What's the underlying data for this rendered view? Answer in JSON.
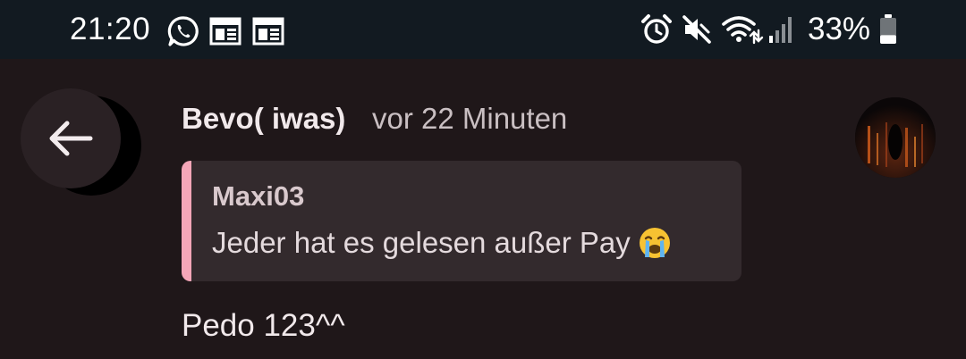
{
  "status_bar": {
    "time": "21:20",
    "battery_percent": "33%",
    "battery_level": 0.33,
    "notification_icons": [
      "whatsapp-icon",
      "calendar-icon",
      "calendar-icon"
    ],
    "system_icons": [
      "alarm-icon",
      "mute-icon",
      "wifi-icon",
      "signal-icon",
      "battery-icon"
    ]
  },
  "post": {
    "sender": "Bevo( iwas)",
    "time_ago": "vor 22 Minuten",
    "quote": {
      "author": "Maxi03",
      "text": "Jeder hat es gelesen außer Pay",
      "emoji": "loudly-crying-face"
    },
    "message": "Pedo 123^^"
  },
  "colors": {
    "background": "#1f1719",
    "status_bar": "#121a21",
    "quote_background": "#332a2d",
    "quote_accent": "#f5a6b8"
  }
}
